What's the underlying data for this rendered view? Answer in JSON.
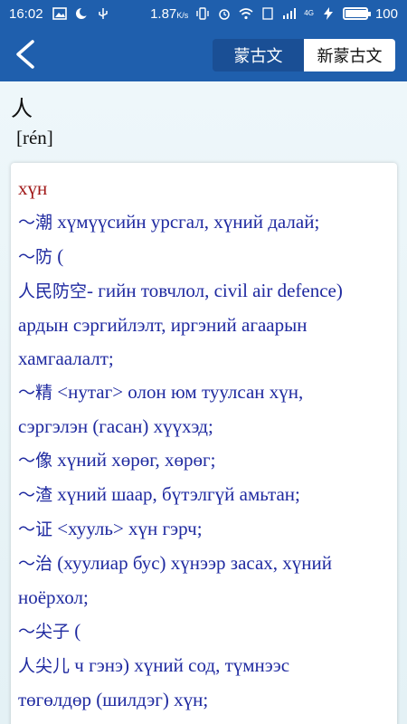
{
  "status_bar": {
    "time": "16:02",
    "net_speed": "1.87",
    "net_unit": "K/s",
    "network": "4G",
    "battery": "100",
    "battery_level": 1.0
  },
  "nav": {
    "tabs": [
      {
        "label": "蒙古文",
        "selected": false
      },
      {
        "label": "新蒙古文",
        "selected": true
      }
    ]
  },
  "entry": {
    "headword": "人",
    "pinyin": "[rén]",
    "lines": [
      {
        "cjk": "",
        "text": "хүн",
        "style": "head"
      },
      {
        "cjk": "～潮",
        "text": " хүмүүсийн урсгал, хүний далай;"
      },
      {
        "cjk": "～防",
        "text": " ("
      },
      {
        "cjk": "人民防空",
        "text": "- гийн товчлол, civil air defence)"
      },
      {
        "cjk": "",
        "text": "ардын сэргийлэлт, иргэний агаарын"
      },
      {
        "cjk": "",
        "text": "хамгаалалт;"
      },
      {
        "cjk": "～精",
        "text": " <нутаг> олон юм туулсан хүн,"
      },
      {
        "cjk": "",
        "text": "сэргэлэн (гасан) хүүхэд;"
      },
      {
        "cjk": "～像",
        "text": " хүний хөрөг, хөрөг;"
      },
      {
        "cjk": "～渣",
        "text": " хүний шаар, бүтэлгүй амьтан;"
      },
      {
        "cjk": "～证",
        "text": " <хууль> хүн гэрч;"
      },
      {
        "cjk": "～治",
        "text": " (хуулиар бус) хүнээр засах, хүний"
      },
      {
        "cjk": "",
        "text": "ноёрхол;"
      },
      {
        "cjk": "～尖子",
        "text": " ("
      },
      {
        "cjk": "人尖儿",
        "text": " ч гэнэ) хүний сод, түмнээс"
      },
      {
        "cjk": "",
        "text": "төгөлдөр (шилдэг) хүн;"
      }
    ]
  },
  "colors": {
    "primary": "#1f5fad",
    "tab_off": "#1a4f95",
    "definition_text": "#1f2aa0",
    "headword_cyrillic": "#a01818",
    "background": "#eaf5f8"
  },
  "icons": [
    "image-icon",
    "moon-icon",
    "usb-icon",
    "vibrate-icon",
    "alarm-icon",
    "wifi-icon",
    "sim-icon",
    "signal-icon",
    "charging-icon",
    "battery-icon",
    "back-arrow-icon"
  ]
}
